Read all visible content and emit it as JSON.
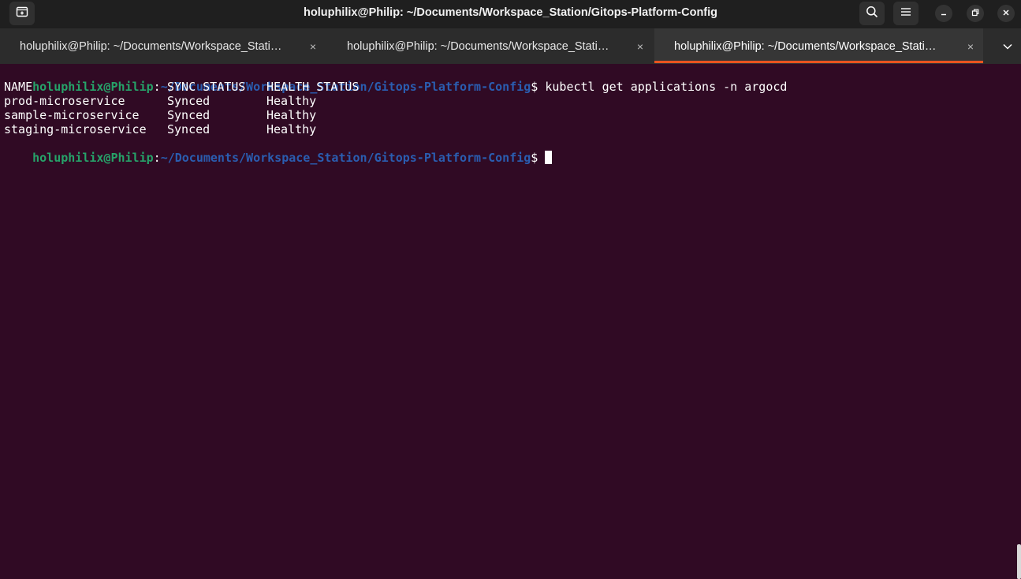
{
  "window": {
    "title": "holuphilix@Philip: ~/Documents/Workspace_Station/Gitops-Platform-Config",
    "icons": [
      "new-tab-icon",
      "search-icon",
      "hamburger-menu-icon",
      "minimize-icon",
      "restore-icon",
      "close-icon"
    ]
  },
  "tabs": [
    {
      "label": "holuphilix@Philip: ~/Documents/Workspace_Stati…",
      "close": "×",
      "active": false
    },
    {
      "label": "holuphilix@Philip: ~/Documents/Workspace_Stati…",
      "close": "×",
      "active": false
    },
    {
      "label": "holuphilix@Philip: ~/Documents/Workspace_Stati…",
      "close": "×",
      "active": true
    }
  ],
  "terminal": {
    "prompt_user": "holuphilix@Philip",
    "prompt_sep": ":",
    "prompt_path": "~/Documents/Workspace_Station/Gitops-Platform-Config",
    "prompt_dollar": "$",
    "command": "kubectl get applications -n argocd",
    "table_header": [
      "NAME",
      "SYNC STATUS",
      "HEALTH STATUS"
    ],
    "rows": [
      [
        "prod-microservice",
        "Synced",
        "Healthy"
      ],
      [
        "sample-microservice",
        "Synced",
        "Healthy"
      ],
      [
        "staging-microservice",
        "Synced",
        "Healthy"
      ]
    ]
  },
  "colors": {
    "terminal_bg": "#300a24",
    "prompt_user": "#26a269",
    "prompt_path": "#2a5db0",
    "tab_accent": "#e95420"
  }
}
